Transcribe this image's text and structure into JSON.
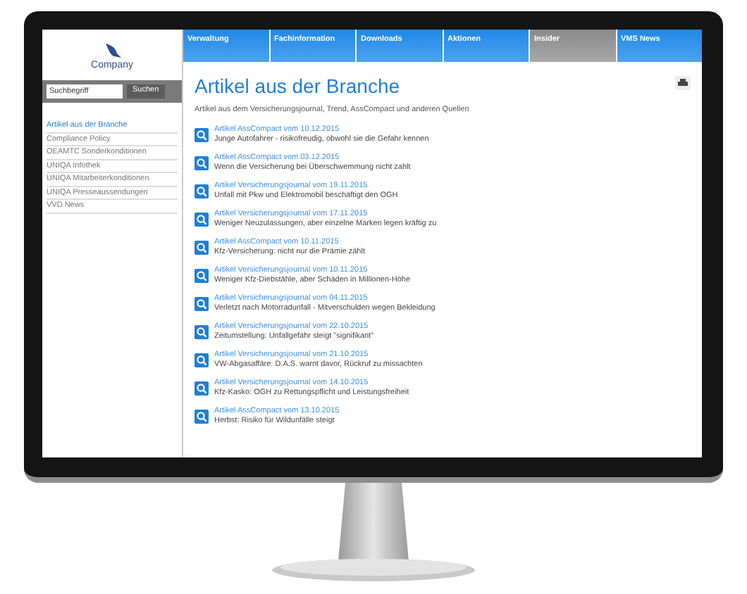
{
  "logo": {
    "text": "Company"
  },
  "search": {
    "placeholder": "Suchbegriff",
    "button": "Suchen"
  },
  "sidebar": {
    "items": [
      {
        "label": "Artikel aus der Branche",
        "selected": true
      },
      {
        "label": "Compliance Policy",
        "selected": false
      },
      {
        "label": "OEAMTC Sonderkonditionen",
        "selected": false
      },
      {
        "label": "UNIQA Infothek",
        "selected": false
      },
      {
        "label": "UNIQA Mitarbeiterkonditionen",
        "selected": false
      },
      {
        "label": "UNIQA Presseaussendungen",
        "selected": false
      },
      {
        "label": "VVD News",
        "selected": false
      }
    ]
  },
  "nav": {
    "tabs": [
      {
        "label": "Verwaltung",
        "selected": false
      },
      {
        "label": "Fachinformation",
        "selected": false
      },
      {
        "label": "Downloads",
        "selected": false
      },
      {
        "label": "Aktionen",
        "selected": false
      },
      {
        "label": "Insider",
        "selected": true
      },
      {
        "label": "VMS News",
        "selected": false
      }
    ]
  },
  "page": {
    "title": "Artikel aus der Branche",
    "subtitle": "Artikel aus dem Versicherungsjournal, Trend, AssCompact und anderen Quellen"
  },
  "articles": [
    {
      "title": "Artikel AssCompact vom 10.12.2015",
      "text": "Junge Autofahrer - risikofreudig, obwohl sie die Gefahr kennen"
    },
    {
      "title": "Artikel AssCompact vom 03.12.2015",
      "text": "Wenn die Versicherung bei Überschwemmung nicht zahlt"
    },
    {
      "title": "Artikel Versicherungsjournal vom 19.11.2015",
      "text": "Unfall mit Pkw und Elektromobil beschäftigt den OGH"
    },
    {
      "title": "Artikel Versicherungsjournal vom 17.11.2015",
      "text": "Weniger Neuzulassungen, aber einzelne Marken legen kräftig zu"
    },
    {
      "title": "Artikel AssCompact vom 10.11.2015",
      "text": "Kfz-Versicherung: nicht nur die Prämie zählt"
    },
    {
      "title": "Artikel Versicherungsjournal vom 10.11.2015",
      "text": "Weniger Kfz-Diebstähle, aber Schäden in Millionen-Höhe"
    },
    {
      "title": "Artikel Versicherungsjournal vom 04.11.2015",
      "text": "Verletzt nach Motorradunfall - Mitverschulden wegen Bekleidung"
    },
    {
      "title": "Artikel Versicherungsjournal vom 22.10.2015",
      "text": "Zeitumstellung: Unfallgefahr steigt \"signifikant\""
    },
    {
      "title": "Artikel Versicherungsjournal vom 21.10.2015",
      "text": "VW-Abgasaffäre: D.A.S. warnt davor, Rückruf zu missachten"
    },
    {
      "title": "Artikel Versicherungsjournal vom 14.10.2015",
      "text": "Kfz-Kasko: OGH zu Rettungspflicht und Leistungsfreiheit"
    },
    {
      "title": "Artikel AssCompact vom 13.10.2015",
      "text": "Herbst: Risiko für Wildunfälle steigt"
    }
  ]
}
